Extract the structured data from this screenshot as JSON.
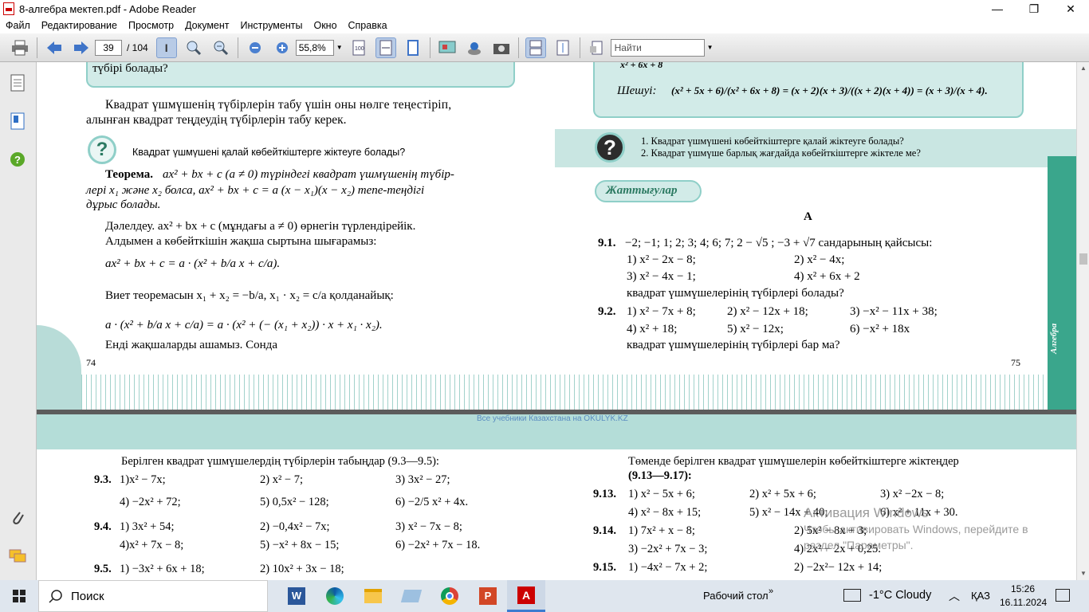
{
  "window": {
    "title": "8-алгебра мектеп.pdf - Adobe Reader",
    "minimize": "—",
    "maximize": "❐",
    "close": "✕"
  },
  "menu": [
    "Файл",
    "Редактирование",
    "Просмотр",
    "Документ",
    "Инструменты",
    "Окно",
    "Справка"
  ],
  "toolbar": {
    "current_page": "39",
    "page_total": "/ 104",
    "zoom": "55,8%",
    "find_placeholder": "Найти"
  },
  "page_left": {
    "top_box_line": "түбірі болады?",
    "intro": "Квадрат үшмүшенің түбірлерін табу үшін оны нөлге теңестіріп,",
    "intro2": "алынған квадрат теңдеудің түбірлерін табу керек.",
    "question": "Квадрат үшмүшені қалай көбейткіштерге жіктеуге болады?",
    "theorem_head": "Теорема.",
    "theorem_1": "ax² + bx + c (a ≠ 0) түріндегі квадрат үшмүшенің түбір-",
    "theorem_2": "лері x₁ және x₂ болса, ax² + bx + c = a (x − x₁)(x − x₂) тепе-теңдігі",
    "theorem_3": "дұрыс болады.",
    "proof_1": "Дәлелдеу. ax² + bx + c (мұндағы a ≠ 0) өрнегін түрлендірейік.",
    "proof_2": "Алдымен a көбейткішін жақша сыртына шығарамыз:",
    "formula_1": "ax² + bx + c = a · (x² + b/a x + c/a).",
    "vieta": "Виет теоремасын x₁ + x₂ = −b/a, x₁ · x₂ = c/a қолданайық:",
    "formula_2": "a · (x² + b/a x + c/a) = a · (x² + (− (x₁ + x₂)) · x + x₁ · x₂).",
    "proof_end": "Енді жақшаларды ашамыз. Сонда",
    "page_number": "74"
  },
  "page_right": {
    "top_formula": "x² + 6x + 8",
    "solution_label": "Шешуі:",
    "solution": "(x² + 5x + 6)/(x² + 6x + 8) = (x + 2)(x + 3)/((x + 2)(x + 4)) = (x + 3)/(x + 4).",
    "q1": "1.  Квадрат үшмүшені көбейткіштерге қалай жіктеуге болады?",
    "q2": "2.  Квадрат үшмүше барлық жағдайда көбейткіштерге жіктеле ме?",
    "exercises": "Жаттығулар",
    "level": "А",
    "ex91_num": "9.1.",
    "ex91": "−2; −1; 1; 2; 3; 4; 6; 7; 2 − √5 ; −3 + √7 сандарының қайсысы:",
    "ex91_a": "1) x² − 2x − 8;",
    "ex91_b": "2) x² − 4x;",
    "ex91_c": "3) x² − 4x − 1;",
    "ex91_d": "4) x² + 6x + 2",
    "ex91_end": "квадрат үшмүшелерінің түбірлері болады?",
    "ex92_num": "9.2.",
    "ex92_a": "1) x² − 7x + 8;",
    "ex92_b": "2) x² − 12x + 18;",
    "ex92_c": "3) −x² − 11x + 38;",
    "ex92_d": "4) x² + 18;",
    "ex92_e": "5) x² − 12x;",
    "ex92_f": "6) −x² + 18x",
    "ex92_end": "квадрат үшмүшелерінің түбірлері бар ма?",
    "page_number": "75",
    "side_tab": "Алгебра"
  },
  "page_bottom": {
    "watermark": "Все учебники Казахстана на OKULYK.KZ",
    "left_title": "Берілген квадрат үшмүшелердің түбірлерін табыңдар (9.3—9.5):",
    "ex93_num": "9.3.",
    "ex93": [
      "1)x² − 7x;",
      "2) x² − 7;",
      "3)  3x² − 27;",
      "4) −2x² + 72;",
      "5) 0,5x² − 128;",
      "6) −2/5 x² + 4x."
    ],
    "ex94_num": "9.4.",
    "ex94": [
      "1) 3x² + 54;",
      "2) −0,4x² − 7x;",
      "3) x² − 7x − 8;",
      "4)x² + 7x − 8;",
      "5) −x² + 8x − 15;",
      "6) −2x² + 7x − 18."
    ],
    "ex95_num": "9.5.",
    "ex95": [
      "1) −3x² + 6x + 18;",
      "2) 10x² + 3x − 18;"
    ],
    "right_title": "Төменде берілген квадрат үшмүшелерін көбейткіштерге жіктеңдер",
    "right_title2": "(9.13—9.17):",
    "ex913_num": "9.13.",
    "ex913": [
      "1) x² − 5x + 6;",
      "2) x² + 5x + 6;",
      "3) x² −2x − 8;",
      "4) x² − 8x + 15;",
      "5) x² − 14x + 40;",
      "6) x² + 11x + 30."
    ],
    "ex914_num": "9.14.",
    "ex914": [
      "1) 7x² + x − 8;",
      "2) 5x² − 8x + 3;",
      "3) −2x² + 7x − 3;",
      "4) 2x² − 2x + 0,25."
    ],
    "ex915_num": "9.15.",
    "ex915": [
      "1) −4x² − 7x + 2;",
      "2) −2x²− 12x + 14;"
    ],
    "activation_1": "Активация Windows",
    "activation_2": "Чтобы активировать Windows, перейдите в",
    "activation_3": "раздел \"Параметры\"."
  },
  "taskbar": {
    "search": "Поиск",
    "desktop": "Рабочий стол",
    "weather": "-1°C  Cloudy",
    "lang": "ҚАЗ",
    "time": "15:26",
    "date": "16.11.2024"
  }
}
